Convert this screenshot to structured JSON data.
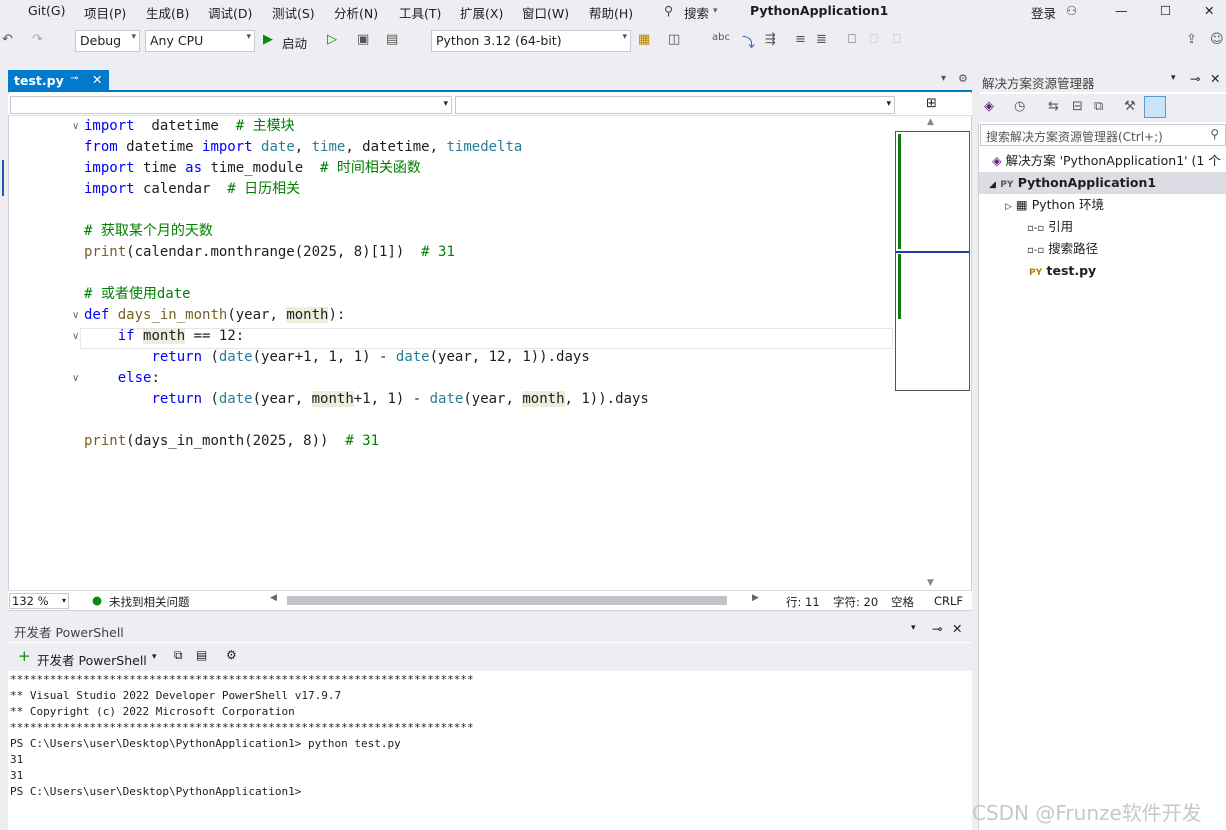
{
  "menu": [
    "Git(G)",
    "项目(P)",
    "生成(B)",
    "调试(D)",
    "测试(S)",
    "分析(N)",
    "工具(T)",
    "扩展(X)",
    "窗口(W)",
    "帮助(H)"
  ],
  "search_label": "搜索",
  "app_title": "PythonApplication1",
  "signin": "登录",
  "toolbar": {
    "config": "Debug",
    "platform": "Any CPU",
    "start_label": "启动",
    "interpreter": "Python 3.12 (64-bit)"
  },
  "editor": {
    "tab_name": "test.py",
    "lines": [
      {
        "parts": [
          [
            "kw",
            "import"
          ],
          [
            "",
            "  datetime  "
          ],
          [
            "cm",
            "# 主模块"
          ]
        ]
      },
      {
        "parts": [
          [
            "kw",
            "from"
          ],
          [
            "",
            " datetime "
          ],
          [
            "kw",
            "import"
          ],
          [
            "",
            " "
          ],
          [
            "bi",
            "date"
          ],
          [
            "",
            ", "
          ],
          [
            "bi",
            "time"
          ],
          [
            "",
            ", datetime, "
          ],
          [
            "bi",
            "timedelta"
          ]
        ]
      },
      {
        "parts": [
          [
            "kw",
            "import"
          ],
          [
            "",
            " time "
          ],
          [
            "kw",
            "as"
          ],
          [
            "",
            " time_module  "
          ],
          [
            "cm",
            "# 时间相关函数"
          ]
        ]
      },
      {
        "parts": [
          [
            "kw",
            "import"
          ],
          [
            "",
            " calendar  "
          ],
          [
            "cm",
            "# 日历相关"
          ]
        ]
      },
      {
        "parts": []
      },
      {
        "parts": [
          [
            "cm",
            "# 获取某个月的天数"
          ]
        ]
      },
      {
        "parts": [
          [
            "fn",
            "print"
          ],
          [
            "",
            "(calendar.monthrange(2025, 8)[1])  "
          ],
          [
            "cm",
            "# 31"
          ]
        ]
      },
      {
        "parts": []
      },
      {
        "parts": [
          [
            "cm",
            "# 或者使用date"
          ]
        ]
      },
      {
        "parts": [
          [
            "kw",
            "def"
          ],
          [
            "",
            " "
          ],
          [
            "fn",
            "days_in_month"
          ],
          [
            "",
            "(year, "
          ],
          [
            "hl",
            "month"
          ],
          [
            "",
            "):"
          ]
        ]
      },
      {
        "parts": [
          [
            "",
            "    "
          ],
          [
            "kw",
            "if"
          ],
          [
            "",
            " "
          ],
          [
            "hl",
            "month"
          ],
          [
            "",
            " == 12:"
          ]
        ]
      },
      {
        "parts": [
          [
            "",
            "        "
          ],
          [
            "kw",
            "return"
          ],
          [
            "",
            " ("
          ],
          [
            "bi",
            "date"
          ],
          [
            "",
            "(year+1, 1, 1) - "
          ],
          [
            "bi",
            "date"
          ],
          [
            "",
            "(year, 12, 1)).days"
          ]
        ]
      },
      {
        "parts": [
          [
            "",
            "    "
          ],
          [
            "kw",
            "else"
          ],
          [
            "",
            ":"
          ]
        ]
      },
      {
        "parts": [
          [
            "",
            "        "
          ],
          [
            "kw",
            "return"
          ],
          [
            "",
            " ("
          ],
          [
            "bi",
            "date"
          ],
          [
            "",
            "(year, "
          ],
          [
            "hl",
            "month"
          ],
          [
            "",
            "+1, 1) - "
          ],
          [
            "bi",
            "date"
          ],
          [
            "",
            "(year, "
          ],
          [
            "hl",
            "month"
          ],
          [
            "",
            ", 1)).days"
          ]
        ]
      },
      {
        "parts": []
      },
      {
        "parts": [
          [
            "fn",
            "print"
          ],
          [
            "",
            "(days_in_month(2025, 8))  "
          ],
          [
            "cm",
            "# 31"
          ]
        ]
      }
    ]
  },
  "status": {
    "zoom": "132 %",
    "issues": "未找到相关问题",
    "line": "行: 11",
    "col": "字符: 20",
    "ws": "空格",
    "eol": "CRLF"
  },
  "powershell": {
    "title": "开发者 PowerShell",
    "new_label": "开发者 PowerShell",
    "output": "**********************************************************************\n** Visual Studio 2022 Developer PowerShell v17.9.7\n** Copyright (c) 2022 Microsoft Corporation\n**********************************************************************\nPS C:\\Users\\user\\Desktop\\PythonApplication1> python test.py\n31\n31\nPS C:\\Users\\user\\Desktop\\PythonApplication1>"
  },
  "solution": {
    "title": "解决方案资源管理器",
    "search_placeholder": "搜索解决方案资源管理器(Ctrl+;)",
    "root": "解决方案 'PythonApplication1' (1 个",
    "project": "PythonApplication1",
    "env": "Python 环境",
    "refs": "引用",
    "paths": "搜索路径",
    "file": "test.py"
  },
  "watermark": "CSDN @Frunze软件开发"
}
